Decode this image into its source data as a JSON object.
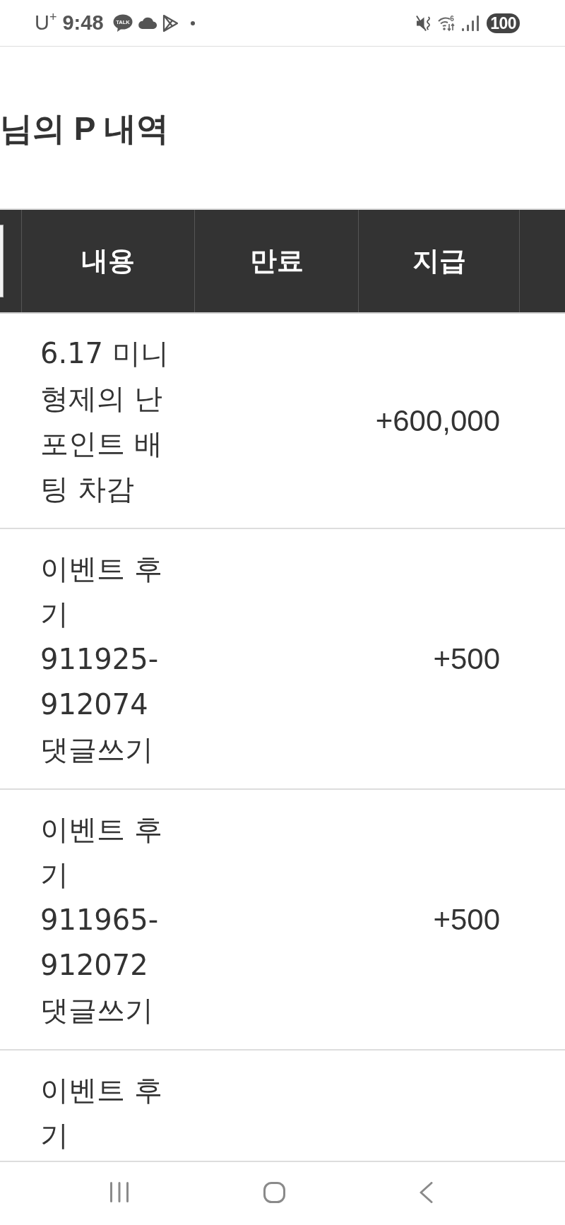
{
  "status_bar": {
    "carrier": "U$^{+}$",
    "time": "9:48",
    "chat_badge": "TALK",
    "wifi_label": "6",
    "battery": "100"
  },
  "title": "님의 P 내역",
  "table": {
    "columns": [
      "내용",
      "만료",
      "지급"
    ],
    "rows": [
      {
        "content": "6.17 미니 형제의 난 포인트 배팅 차감",
        "amount": "+600,000"
      },
      {
        "content": "이벤트 후기 911925-912074 댓글쓰기",
        "amount": "+500"
      },
      {
        "content": "이벤트 후기 911965-912072 댓글쓰기",
        "amount": "+500"
      },
      {
        "content": "이벤트 후기"
      }
    ]
  }
}
